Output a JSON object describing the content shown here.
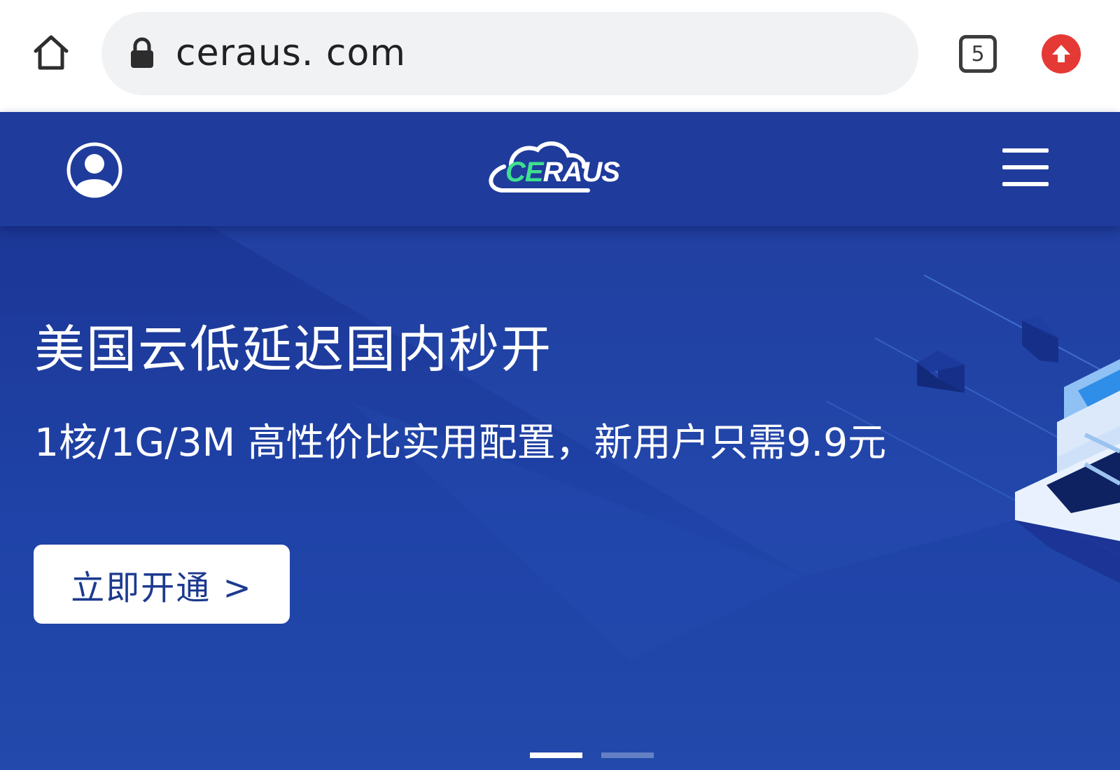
{
  "browser": {
    "url": "ceraus. com",
    "tab_count": "5"
  },
  "header": {
    "logo": {
      "part1": "CE",
      "part2": "RAUS"
    }
  },
  "hero": {
    "title": "美国云低延迟国内秒开",
    "subtitle": "1核/1G/3M 高性价比实用配置，新用户只需9.9元",
    "cta_label": "立即开通 >",
    "slides_total": 2,
    "slide_active": 1
  },
  "colors": {
    "header_bg": "#1f3b9c",
    "hero_bg": "#1f43a8",
    "update_badge": "#e53935",
    "logo_accent": "#3ee08f",
    "cta_text": "#1d3a8f"
  },
  "icons": {
    "home": "home-icon",
    "lock": "lock-icon",
    "tabs": "tab-switcher-icon",
    "update": "update-arrow-icon",
    "user": "user-avatar-icon",
    "logo_cloud": "cloud-logo-icon",
    "menu": "hamburger-menu-icon"
  }
}
